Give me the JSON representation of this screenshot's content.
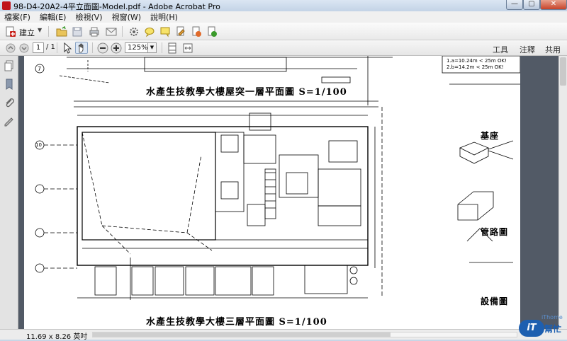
{
  "window": {
    "title": "98-D4-20A2-4平立面圖-Model.pdf - Adobe Acrobat Pro",
    "min_glyph": "—",
    "max_glyph": "▢",
    "close_glyph": "✕"
  },
  "menu": [
    {
      "label": "檔案(F)"
    },
    {
      "label": "編輯(E)"
    },
    {
      "label": "檢視(V)"
    },
    {
      "label": "視窗(W)"
    },
    {
      "label": "說明(H)"
    }
  ],
  "toolbar": {
    "create_label": "建立",
    "icons": [
      "create-pdf-icon",
      "open-folder-icon",
      "save-icon",
      "print-icon",
      "email-icon",
      "settings-gear-icon",
      "comment-icon",
      "sticky-note-icon",
      "sign-icon",
      "export-icon",
      "certify-icon"
    ]
  },
  "nav": {
    "page_current": "1",
    "page_total": "/ 1",
    "zoom": "125%",
    "tools": "工具",
    "comment": "注釋",
    "share": "共用"
  },
  "document": {
    "caption_top": "水產生技教學大樓屋突一層平面圖 S=1/100",
    "caption_bottom": "水產生技教學大樓三層平面圖 S=1/100",
    "right_caption_1": "基座",
    "right_caption_2": "管路圖",
    "right_caption_3": "設備圖",
    "axis_label_7": "7",
    "axis_label_10": "10",
    "note_line_1": "1.a=10.24m < 25m OK!",
    "note_line_2": "2.b=14.2m < 25m OK!"
  },
  "status": {
    "page_size": "11.69 x 8.26 英吋"
  },
  "watermark": {
    "badge": "iT",
    "text": "幫忙",
    "sub": "iThome"
  },
  "colors": {
    "accent": "#1d5fb0",
    "close_red": "#c7442a",
    "doc_bg": "#525a66"
  }
}
